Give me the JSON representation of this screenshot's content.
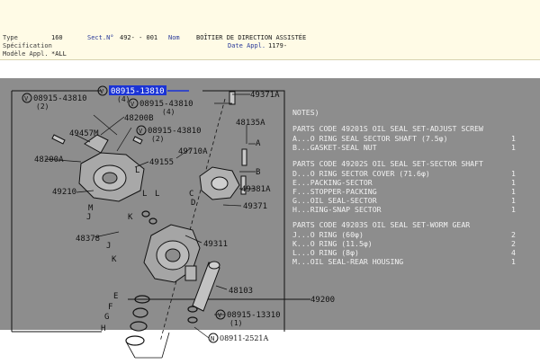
{
  "header": {
    "type_label": "Type",
    "type_value": "160",
    "sect_label": "Sect.N°",
    "sect_value": "492-  - 001",
    "nom_label": "Nom",
    "nom_value": "BOÎTIER DE DIRECTION ASSISTÉE",
    "spec_label": "Spécification",
    "date_label": "Date Appl.",
    "date_value": "1179-",
    "model_label": "Modèle Appl.",
    "model_value": "*ALL"
  },
  "diagram": {
    "selected_label": "08915-13810",
    "parts": {
      "p49371A": "49371A",
      "p08915_43810_top": "08915-43810",
      "qty_top": "(4)",
      "p08915_43810_left": "08915-43810",
      "qty_left": "(2)",
      "p48200B": "48200B",
      "p48135A": "48135A",
      "p08915_43810_mid": "08915-43810",
      "qty_mid": "(2)",
      "p49457M": "49457M",
      "p49710A": "49710A",
      "p49155": "49155",
      "p48200A": "48200A",
      "p49210": "49210",
      "p49381A": "49381A",
      "p49371": "49371",
      "p48378": "48378",
      "p49311": "49311",
      "p48103": "48103",
      "p49200": "49200",
      "p08915_13310": "08915-13310",
      "qty_bottom": "(1)",
      "p08911_2521A": "08911-2521A"
    },
    "letters": {
      "A": "A",
      "B": "B",
      "C": "C",
      "D": "D",
      "E": "E",
      "F": "F",
      "G": "G",
      "H": "H",
      "J": "J",
      "K": "K",
      "L": "L",
      "M": "M"
    },
    "circle_v": "V",
    "circle_n": "N"
  },
  "notes": {
    "title": "NOTES)",
    "groups": [
      {
        "code": "PARTS CODE 49201S OIL SEAL SET-ADJUST SCREW",
        "rows": [
          {
            "item": "A...O RING SEAL SECTOR SHAFT (7.5φ)",
            "qty": "1"
          },
          {
            "item": "B...GASKET-SEAL NUT",
            "qty": "1"
          }
        ]
      },
      {
        "code": "PARTS CODE 49202S OIL SEAL SET-SECTOR SHAFT",
        "rows": [
          {
            "item": "D...O RING SECTOR COVER (71.6φ)",
            "qty": "1"
          },
          {
            "item": "E...PACKING-SECTOR",
            "qty": "1"
          },
          {
            "item": "F...STOPPER-PACKING",
            "qty": "1"
          },
          {
            "item": "G...OIL SEAL-SECTOR",
            "qty": "1"
          },
          {
            "item": "H...RING-SNAP SECTOR",
            "qty": "1"
          }
        ]
      },
      {
        "code": "PARTS CODE 49203S OIL SEAL SET-WORM GEAR",
        "rows": [
          {
            "item": "J...O RING (60φ)",
            "qty": "2"
          },
          {
            "item": "K...O RING (11.5φ)",
            "qty": "2"
          },
          {
            "item": "L...O RING (8φ)",
            "qty": "4"
          },
          {
            "item": "M...OIL SEAL-REAR HOUSING",
            "qty": "1"
          }
        ]
      }
    ]
  }
}
